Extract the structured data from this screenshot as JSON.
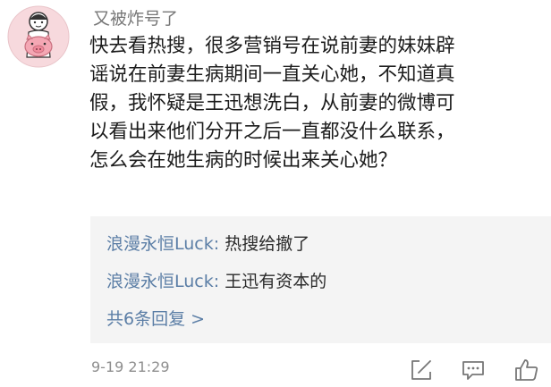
{
  "comment": {
    "username": "又被炸号了",
    "avatar_icon": "pig-avatar-icon",
    "body_lines": [
      "快去看热搜，很多营销号在说前妻的妹妹辟",
      "谣说在前妻生病期间一直关心她，不知道真",
      "假，我怀疑是王迅想洗白，从前妻的微博可",
      "以看出来他们分开之后一直都没什么联系，",
      "怎么会在她生病的时候出来关心她？"
    ],
    "replies": [
      {
        "author": "浪漫永恒Luck",
        "separator": ":",
        "text": "热搜给撤了"
      },
      {
        "author": "浪漫永恒Luck",
        "separator": ":",
        "text": "王迅有资本的"
      }
    ],
    "more_replies_label": "共6条回复 >",
    "timestamp": "9-19 21:29",
    "actions": [
      "edit-icon",
      "comment-icon",
      "like-icon"
    ]
  },
  "colors": {
    "link": "#5b7ea6",
    "meta": "#8e8e8e",
    "reply_bg": "#f4f4f4",
    "avatar_bg": "#f7d9dd",
    "pig": "#f4a7b4"
  }
}
